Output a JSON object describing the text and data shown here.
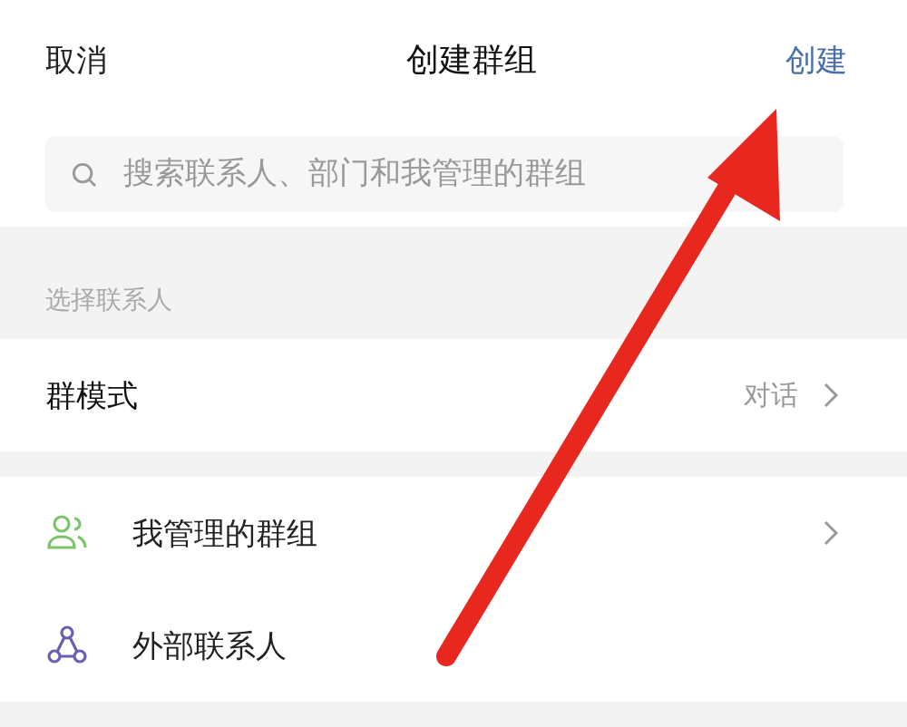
{
  "header": {
    "cancel": "取消",
    "title": "创建群组",
    "create": "创建"
  },
  "search": {
    "placeholder": "搜索联系人、部门和我管理的群组"
  },
  "section_label": "选择联系人",
  "mode_row": {
    "label": "群模式",
    "value": "对话"
  },
  "entries": [
    {
      "label": "我管理的群组",
      "color": "#7cc46a",
      "chevron": true
    },
    {
      "label": "外部联系人",
      "color": "#6a5fb0",
      "chevron": false
    }
  ],
  "annotation": {
    "kind": "arrow"
  }
}
